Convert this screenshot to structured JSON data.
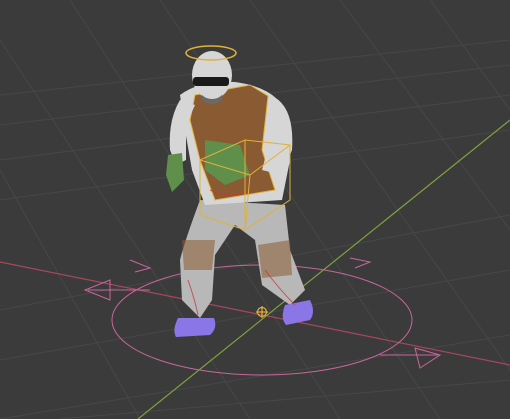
{
  "viewport": {
    "background": "#3b3b3b",
    "grid_color": "#474747",
    "x_axis_color": "#a8475c",
    "y_axis_color": "#7da33d",
    "control_rig_color": "#c7679b",
    "selection_color": "#e0b23a"
  },
  "scene": {
    "character": {
      "skin_color": "#d6d6d6",
      "vest_color": "#8a5a32",
      "pants_color": "#b8b8b8",
      "shoes_color": "#8a76e6",
      "glove_color": "#5f8f4a"
    },
    "icons": [
      "origin-marker-icon",
      "halo-bone-icon",
      "root-control-icon"
    ]
  }
}
